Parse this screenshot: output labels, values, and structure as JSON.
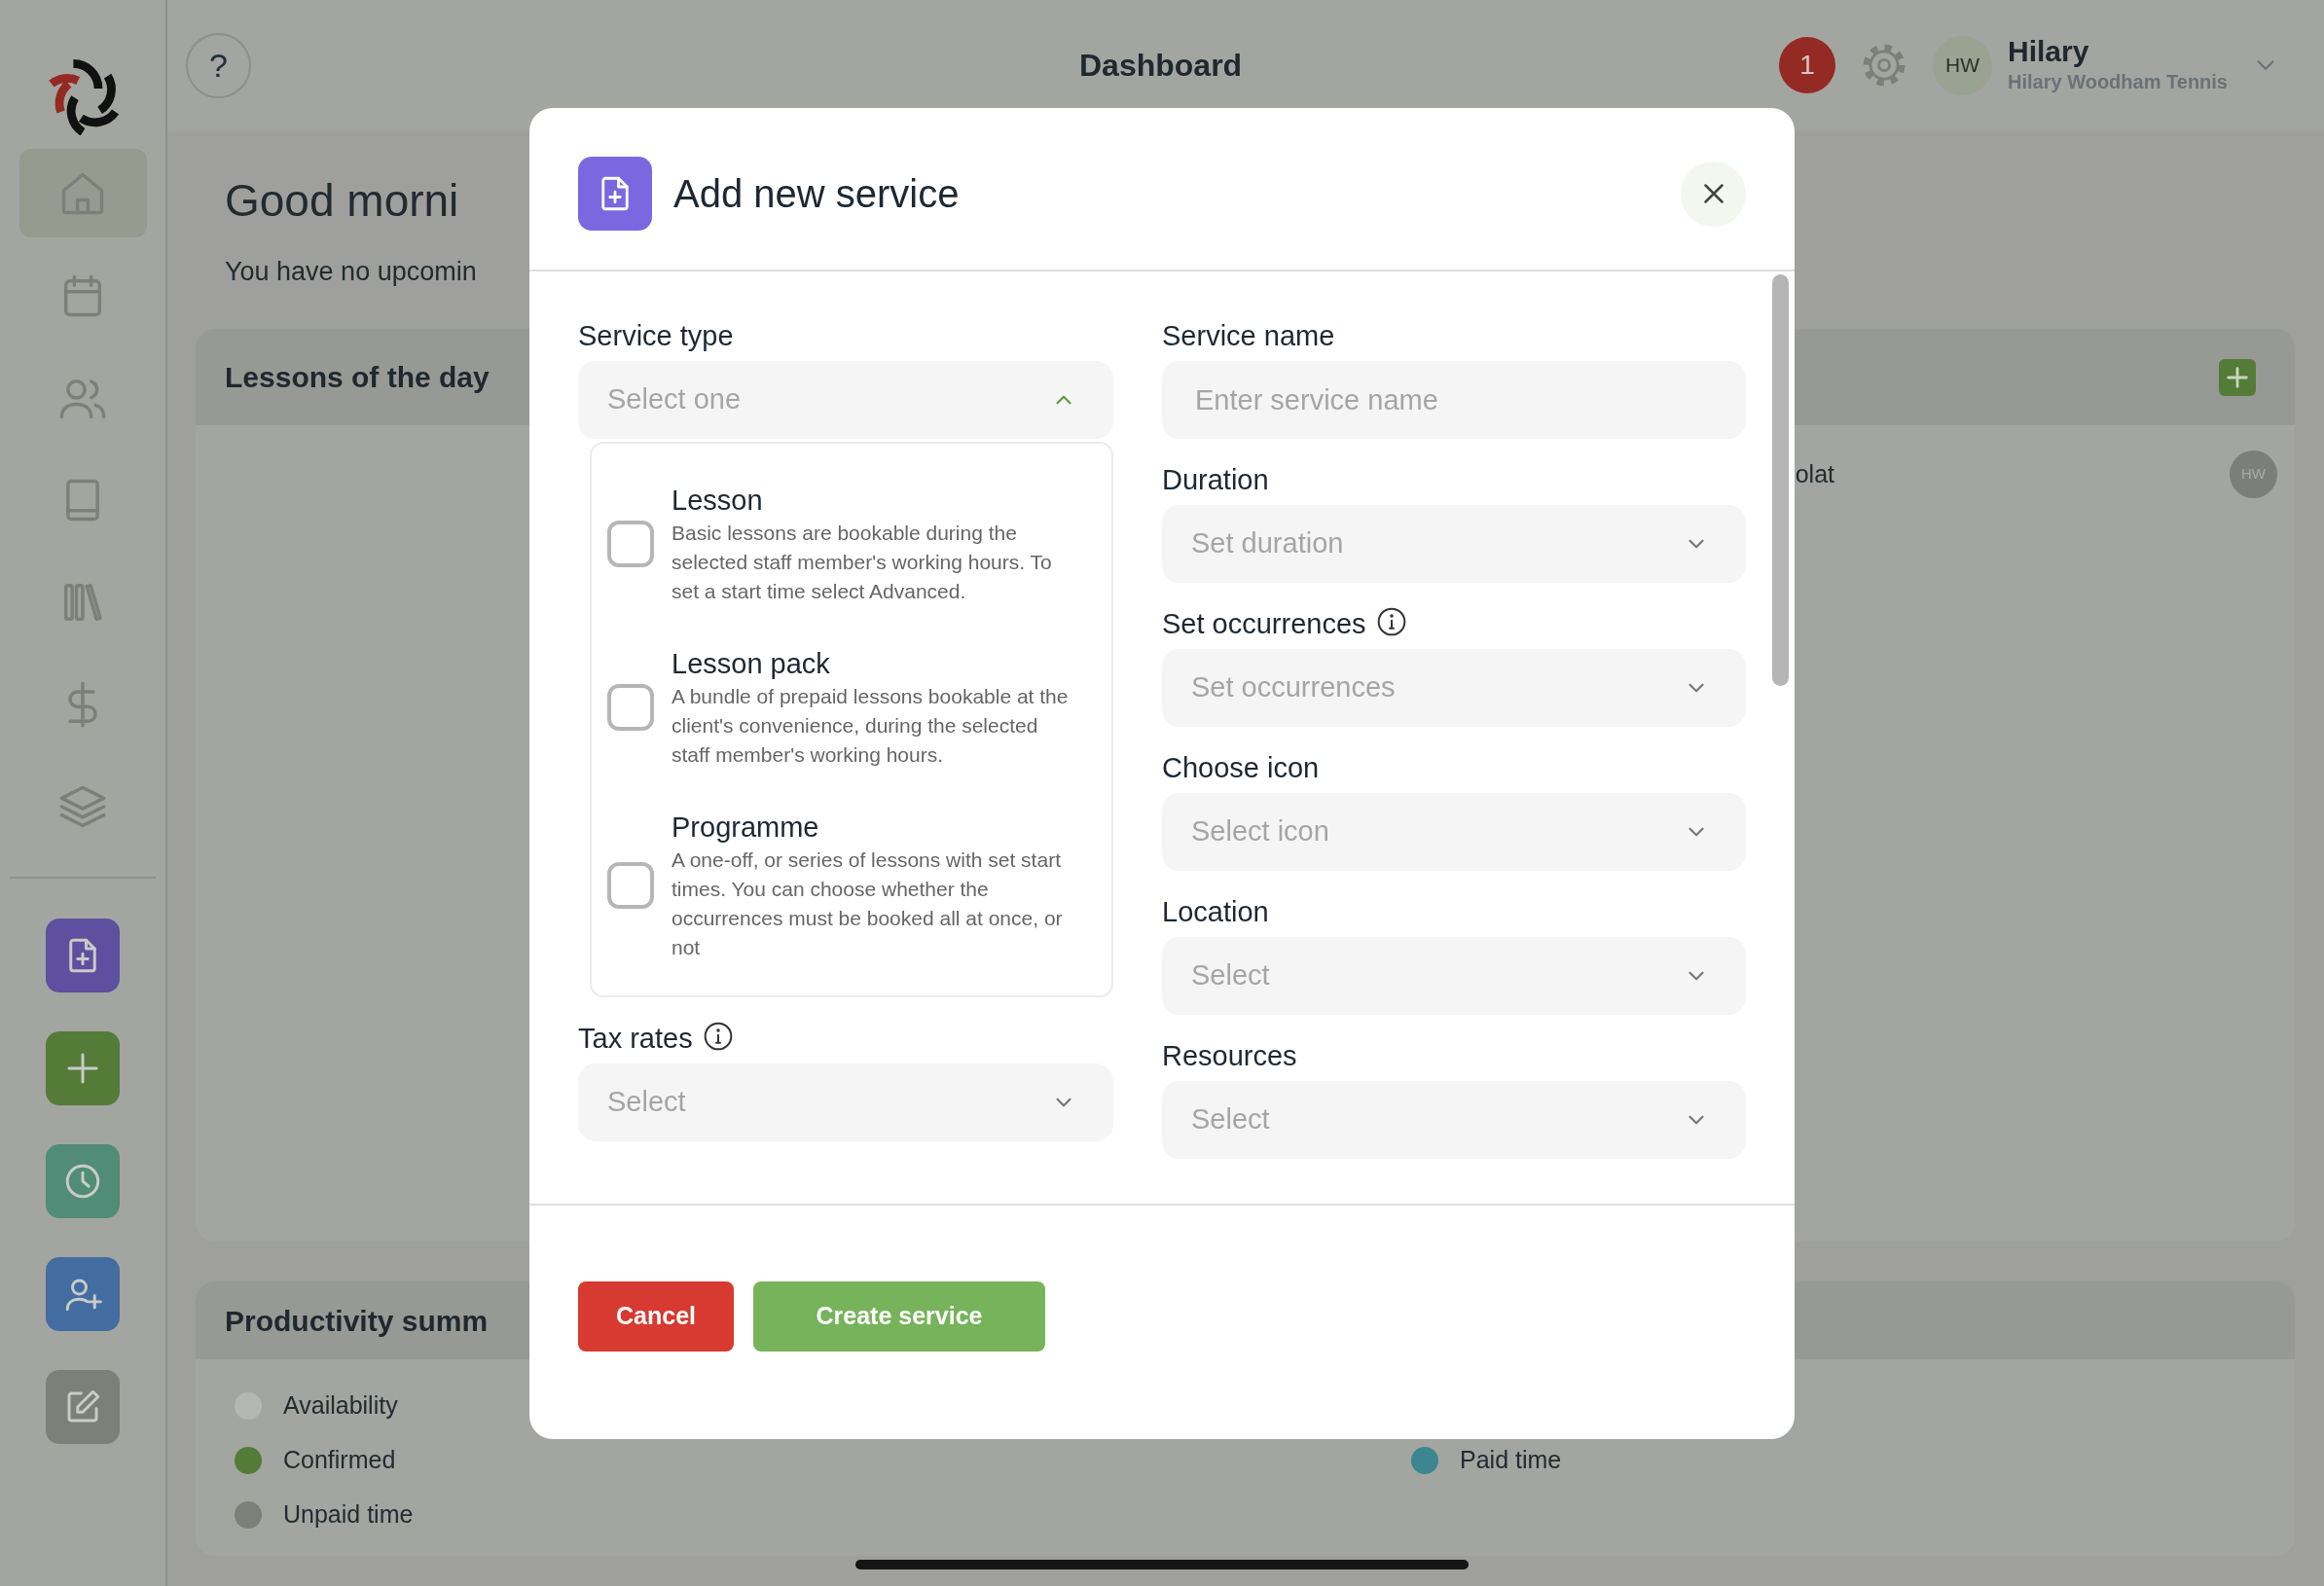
{
  "sidebar": {
    "nav_items": [
      {
        "kind": "home",
        "selected": true
      },
      {
        "kind": "calendar",
        "selected": false
      },
      {
        "kind": "people",
        "selected": false
      },
      {
        "kind": "book",
        "selected": false
      },
      {
        "kind": "library",
        "selected": false
      },
      {
        "kind": "dollar",
        "selected": false
      },
      {
        "kind": "layers",
        "selected": false
      }
    ],
    "quick_actions": [
      {
        "kind": "file-plus",
        "color": "#5e509e"
      },
      {
        "kind": "plus",
        "color": "#557b38"
      },
      {
        "kind": "clock",
        "color": "#508c78"
      },
      {
        "kind": "user-plus",
        "color": "#436da0"
      },
      {
        "kind": "edit",
        "color": "#7c8078"
      }
    ]
  },
  "header": {
    "help_label": "?",
    "title": "Dashboard",
    "notification_count": "1",
    "user": {
      "initials": "HW",
      "name": "Hilary",
      "business": "Hilary Woodham Tennis"
    }
  },
  "dashboard": {
    "greeting": "Good morni",
    "subtitle": "You have no upcomin",
    "lessons_card": {
      "title": "Lessons of the day",
      "rows": [
        {
          "text": "olat",
          "initials": "HW"
        }
      ]
    },
    "productivity_card": {
      "title": "Productivity summ",
      "legend_rows": [
        {
          "items": [
            {
              "label": "Availability",
              "color": "#b5b7b3"
            }
          ]
        },
        {
          "items": [
            {
              "label": "Confirmed",
              "color": "#557b38"
            },
            {
              "label": "Paid time",
              "color": "#3d8590"
            }
          ]
        },
        {
          "items": [
            {
              "label": "Unpaid time",
              "color": "#7c8078"
            }
          ]
        }
      ]
    }
  },
  "modal": {
    "title": "Add new service",
    "left_fields": [
      {
        "kind": "select",
        "label": "Service type",
        "placeholder": "Select one",
        "info": false,
        "expanded": true,
        "options": [
          {
            "title": "Lesson",
            "description": "Basic lessons are bookable during the selected staff member's working hours. To set a start time select Advanced.",
            "checked": false
          },
          {
            "title": "Lesson pack",
            "description": "A bundle of prepaid lessons bookable at the client's convenience, during the selected staff member's working hours.",
            "checked": false
          },
          {
            "title": "Programme",
            "description": "A one-off, or series of lessons with set start times. You can choose whether the occurrences must be booked all at once, or not",
            "checked": false
          }
        ]
      },
      {
        "kind": "select",
        "label": "Tax rates",
        "placeholder": "Select",
        "info": true,
        "expanded": false
      }
    ],
    "right_fields": [
      {
        "kind": "input",
        "label": "Service name",
        "placeholder": "Enter service name",
        "info": false
      },
      {
        "kind": "select",
        "label": "Duration",
        "placeholder": "Set duration",
        "info": false,
        "expanded": false
      },
      {
        "kind": "select",
        "label": "Set occurrences",
        "placeholder": "Set occurrences",
        "info": true,
        "expanded": false
      },
      {
        "kind": "select",
        "label": "Choose icon",
        "placeholder": "Select icon",
        "info": false,
        "expanded": false
      },
      {
        "kind": "select",
        "label": "Location",
        "placeholder": "Select",
        "info": false,
        "expanded": false
      },
      {
        "kind": "select",
        "label": "Resources",
        "placeholder": "Select",
        "info": false,
        "expanded": false
      }
    ],
    "buttons": [
      {
        "kind": "cancel",
        "label": "Cancel"
      },
      {
        "kind": "primary",
        "label": "Create service"
      }
    ]
  }
}
